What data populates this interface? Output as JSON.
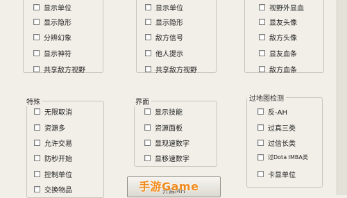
{
  "groups": {
    "units_display": {
      "items": [
        "显示单位",
        "显示隐形",
        "分辨幻象",
        "显示神符",
        "共享敌方视野"
      ]
    },
    "minimap": {
      "items": [
        "显示单位",
        "显示隐形",
        "敌方信号",
        "他人提示",
        "共享敌方视野"
      ]
    },
    "misc_top": {
      "items": [
        "视野外显血",
        "显友头像",
        "敌方头像",
        "显友血条",
        "敌方血条"
      ]
    },
    "special": {
      "title": "特殊",
      "items": [
        "无限取消",
        "资源多",
        "允许交易",
        "防秒开始",
        "控制单位",
        "交换物品"
      ]
    },
    "interface": {
      "title": "界面",
      "items": [
        "显示技能",
        "资源面板",
        "显现速数字",
        "显移速数字"
      ]
    },
    "map_detection": {
      "title": "过地图检测",
      "items": [
        "反-AH",
        "过真三类",
        "过信长类",
        "过Dota IMBA类",
        "卡显单位"
      ]
    }
  },
  "open_button": {
    "label": "开启MH"
  },
  "watermark": {
    "text": "手游Game"
  }
}
